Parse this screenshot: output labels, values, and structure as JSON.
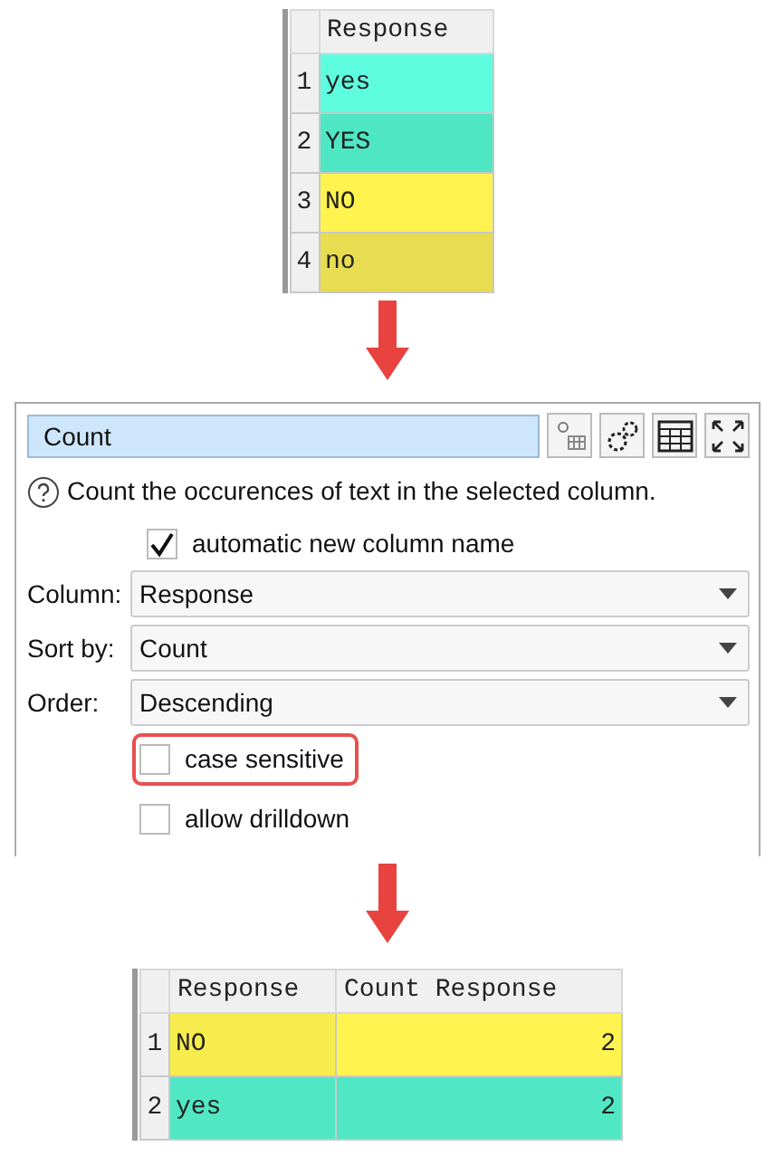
{
  "input_table": {
    "columns": [
      "Response"
    ],
    "rows": [
      {
        "number": "1",
        "cells": [
          "yes"
        ],
        "color": "#5ffde0"
      },
      {
        "number": "2",
        "cells": [
          "YES"
        ],
        "color": "#4fe6c4"
      },
      {
        "number": "3",
        "cells": [
          "NO"
        ],
        "color": "#fff350"
      },
      {
        "number": "4",
        "cells": [
          "no"
        ],
        "color": "#e8dc50"
      }
    ]
  },
  "panel": {
    "title": "Count",
    "description": "Count the occurences of text in the selected column.",
    "auto_name": {
      "label": "automatic new column name",
      "checked": true
    },
    "fields": [
      {
        "label": "Column:",
        "value": "Response"
      },
      {
        "label": "Sort by:",
        "value": "Count"
      },
      {
        "label": "Order:",
        "value": "Descending"
      }
    ],
    "options": [
      {
        "label": "case sensitive",
        "checked": false,
        "highlighted": true
      },
      {
        "label": "allow drilldown",
        "checked": false,
        "highlighted": false
      }
    ]
  },
  "output_table": {
    "columns": [
      "Response",
      "Count Response"
    ],
    "rows": [
      {
        "number": "1",
        "cells": [
          "NO",
          "2"
        ],
        "color": "#fff350"
      },
      {
        "number": "2",
        "cells": [
          "yes",
          "2"
        ],
        "color": "#50e8c4"
      }
    ]
  }
}
